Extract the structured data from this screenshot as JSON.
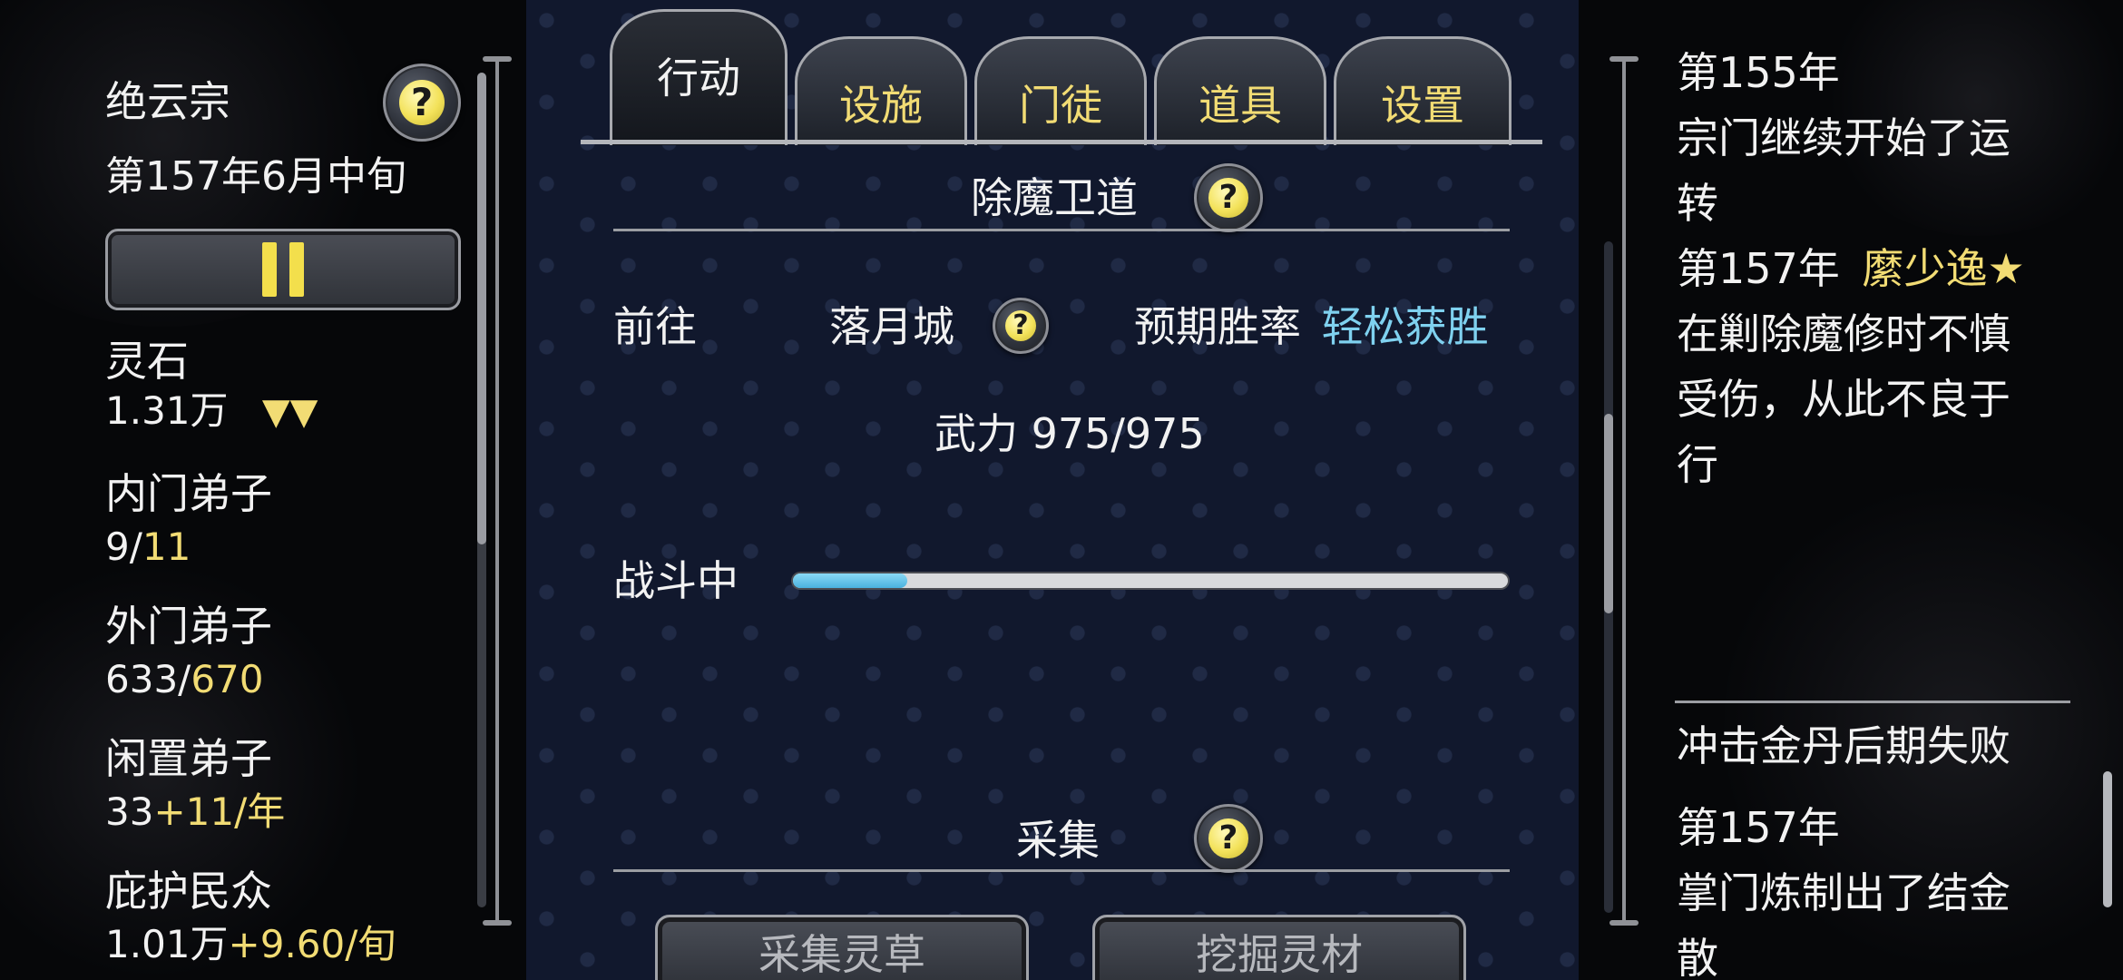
{
  "left": {
    "sect_name": "绝云宗",
    "date": "第157年6月中旬",
    "spirit_stone_label": "灵石",
    "spirit_stone_value": "1.31万",
    "spirit_stone_trend": "▼▼",
    "inner_disciples_label": "内门弟子",
    "inner_disciples_current": "9/",
    "inner_disciples_max": "11",
    "outer_disciples_label": "外门弟子",
    "outer_disciples_current": "633/",
    "outer_disciples_max": "670",
    "idle_disciples_label": "闲置弟子",
    "idle_disciples_current": "33",
    "idle_disciples_rate": "+11/年",
    "protected_people_label": "庇护民众",
    "protected_people_value": "1.01万",
    "protected_people_rate": "+9.60/旬"
  },
  "tabs": [
    {
      "label": "行动",
      "active": true
    },
    {
      "label": "设施",
      "active": false
    },
    {
      "label": "门徒",
      "active": false
    },
    {
      "label": "道具",
      "active": false
    },
    {
      "label": "设置",
      "active": false
    }
  ],
  "center": {
    "section1_title": "除魔卫道",
    "goto_label": "前往",
    "destination": "落月城",
    "win_rate_label": "预期胜率",
    "win_rate_value": "轻松获胜",
    "power": "武力 975/975",
    "status_label": "战斗中",
    "battle_progress": 0.16,
    "section2_title": "采集",
    "button_herbs": "采集灵草",
    "button_dig": "挖掘灵材"
  },
  "log": {
    "entry1_year": "第155年",
    "entry1_line1": "宗门继续开始了运",
    "entry1_line2": "转",
    "entry2_year": "第157年",
    "entry2_name": "縻少逸★",
    "entry2_line1": "在剿除魔修时不慎",
    "entry2_line2": "受伤，从此不良于",
    "entry2_line3": "行",
    "lower_title": "冲击金丹后期失败",
    "entry3_year": "第157年",
    "entry3_line1": "掌门炼制出了结金",
    "entry3_line2": "散"
  },
  "colors": {
    "gold": "#f2dc74",
    "cyan": "#7fd1ef",
    "progress": "#4ab1de",
    "panel_bg": "#11182d"
  },
  "icons": {
    "help": "question-mark-icon",
    "pause": "pause-icon"
  }
}
